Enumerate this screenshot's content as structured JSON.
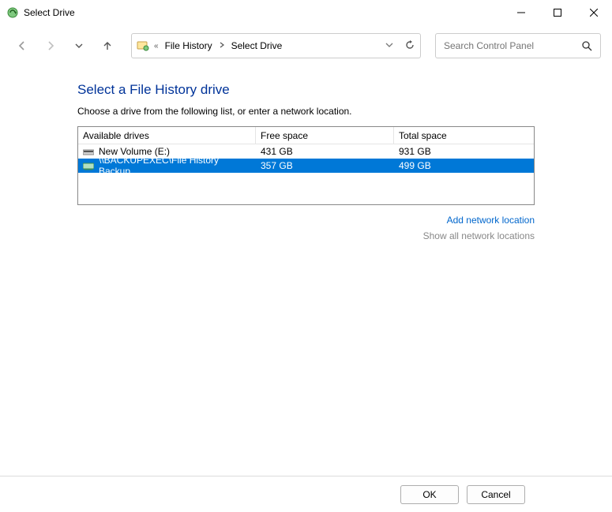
{
  "window": {
    "title": "Select Drive"
  },
  "breadcrumb": {
    "prefix": "«",
    "item1": "File History",
    "item2": "Select Drive"
  },
  "search": {
    "placeholder": "Search Control Panel"
  },
  "main": {
    "heading": "Select a File History drive",
    "subtext": "Choose a drive from the following list, or enter a network location.",
    "columns": {
      "name": "Available drives",
      "free": "Free space",
      "total": "Total space"
    },
    "drives": [
      {
        "name": "New Volume (E:)",
        "free": "431 GB",
        "total": "931 GB",
        "selected": false,
        "type": "local"
      },
      {
        "name": "\\\\BACKUPEXEC\\File History Backup",
        "free": "357 GB",
        "total": "499 GB",
        "selected": true,
        "type": "network"
      }
    ],
    "links": {
      "add": "Add network location",
      "show": "Show all network locations"
    }
  },
  "footer": {
    "ok": "OK",
    "cancel": "Cancel"
  }
}
